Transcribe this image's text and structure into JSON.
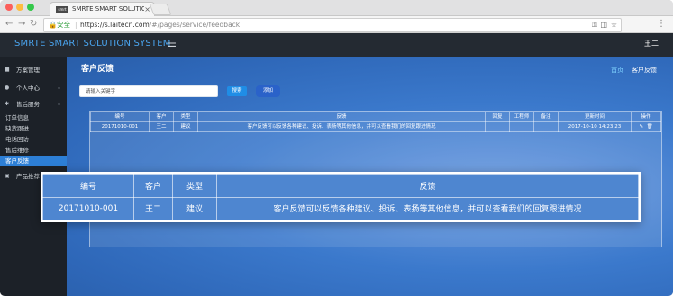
{
  "browser": {
    "tab_title": "SMRTE SMART SOLUTION SYSTEM",
    "favicon_text": "smrt",
    "address": {
      "secure_label": "安全",
      "domain": "https://s.laitecn.com",
      "path": "/#/pages/service/feedback"
    }
  },
  "app": {
    "brand": "SMRTE SMART SOLUTION SYSTEM",
    "user": "王二",
    "sidebar": {
      "items": [
        {
          "label": "方案管理"
        },
        {
          "label": "个人中心"
        },
        {
          "label": "售后服务"
        }
      ],
      "subitems": [
        "订单信息",
        "缺货跟进",
        "电话回访",
        "售后维修",
        "客户反馈"
      ],
      "last_item": "产品推荐"
    },
    "page": {
      "title": "客户反馈",
      "breadcrumb": {
        "home": "首页",
        "current": "客户反馈"
      },
      "search_placeholder": "请输入关键字",
      "search_button": "搜索",
      "add_button": "添加"
    },
    "table": {
      "headers": [
        "编号",
        "客户",
        "类型",
        "反馈",
        "回复",
        "工程师",
        "备注",
        "更新时间",
        "操作"
      ],
      "rows": [
        {
          "id": "20171010-001",
          "customer": "王二",
          "type": "建议",
          "feedback": "客户反馈可以反馈各种建议、投诉、表扬等其他信息，并可以查看我们的回复跟进情况",
          "time": "2017-10-10 14:23:23"
        }
      ]
    },
    "zoom": {
      "headers": [
        "编号",
        "客户",
        "类型",
        "反馈"
      ],
      "row": [
        "20171010-001",
        "王二",
        "建议",
        "客户反馈可以反馈各种建议、投诉、表扬等其他信息，并可以查看我们的回复跟进情况"
      ]
    },
    "colors": {
      "brand": "#4aa4ee",
      "active": "#2d7fd6",
      "topbar": "#242a32"
    }
  }
}
